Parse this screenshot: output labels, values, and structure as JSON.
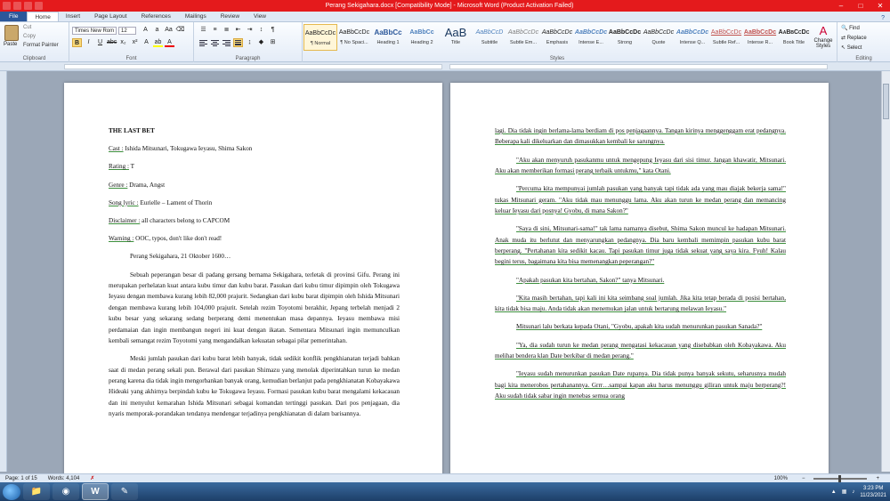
{
  "window": {
    "title": "Perang Sekigahara.docx [Compatibility Mode] - Microsoft Word (Product Activation Failed)"
  },
  "tabs": [
    "File",
    "Home",
    "Insert",
    "Page Layout",
    "References",
    "Mailings",
    "Review",
    "View"
  ],
  "ribbon": {
    "clipboard": {
      "paste": "Paste",
      "cut": "Cut",
      "copy": "Copy",
      "format_painter": "Format Painter",
      "label": "Clipboard"
    },
    "font": {
      "name": "Times New Rom",
      "size": "12",
      "label": "Font"
    },
    "paragraph": {
      "label": "Paragraph"
    },
    "styles": {
      "label": "Styles",
      "items": [
        {
          "preview": "AaBbCcDc",
          "name": "¶ Normal"
        },
        {
          "preview": "AaBbCcDc",
          "name": "¶ No Spaci..."
        },
        {
          "preview": "AaBbCc",
          "name": "Heading 1"
        },
        {
          "preview": "AaBbCc",
          "name": "Heading 2"
        },
        {
          "preview": "AaB",
          "name": "Title"
        },
        {
          "preview": "AaBbCcD",
          "name": "Subtitle"
        },
        {
          "preview": "AaBbCcDc",
          "name": "Subtle Em..."
        },
        {
          "preview": "AaBbCcDc",
          "name": "Emphasis"
        },
        {
          "preview": "AaBbCcDc",
          "name": "Intense E..."
        },
        {
          "preview": "AaBbCcDc",
          "name": "Strong"
        },
        {
          "preview": "AaBbCcDc",
          "name": "Quote"
        },
        {
          "preview": "AaBbCcDc",
          "name": "Intense Q..."
        },
        {
          "preview": "AaBbCcDc",
          "name": "Subtle Ref..."
        },
        {
          "preview": "AaBbCcDc",
          "name": "Intense R..."
        },
        {
          "preview": "AaBbCcDc",
          "name": "Book Title"
        }
      ],
      "change": "Change Styles"
    },
    "editing": {
      "find": "Find",
      "replace": "Replace",
      "select": "Select",
      "label": "Editing"
    }
  },
  "doc_left": {
    "title": "THE LAST BET",
    "lines": [
      {
        "k": "Cast :",
        "v": " Ishida Mitsunari, Tokugawa Ieyasu, Shima Sakon"
      },
      {
        "k": "Rating :",
        "v": " T"
      },
      {
        "k": "Genre :",
        "v": " Drama, Angst"
      },
      {
        "k": "Song lyric :",
        "v": " Eurielle – Lament of Thorin"
      },
      {
        "k": "Disclaimer :",
        "v": " all characters belong to CAPCOM"
      },
      {
        "k": "Warning :",
        "v": " OOC, typos, don't like don't read!"
      }
    ],
    "dateline": "Perang Sekigahara, 21 Oktober 1600…",
    "para1": "Sebuah peperangan besar di padang gersang bernama Sekigahara, terletak di provinsi Gifu. Perang ini merupakan perhelatan kuat antara kubu timur dan kubu barat. Pasukan dari kubu timur dipimpin oleh Tokugawa Ieyasu dengan membawa kurang lebih 82,000 prajurit. Sedangkan dari kubu barat dipimpin oleh Ishida Mitsunari dengan membawa kurang lebih 104,000 prajurit. Setelah rezim Toyotomi berakhir, Jepang terbelah menjadi 2 kubu besar yang sekarang sedang berperang demi menentukan masa depannya. Ieyasu membawa misi perdamaian dan ingin membangun negeri ini kuat dengan ikatan. Sementara Mitsunari ingin memuncul­kan kembali semangat rezim Toyotomi yang mengandalkan kekuatan sebagai pilar pemerintahan.",
    "para2": "Meski jumlah pasukan dari kubu barat lebih banyak, tidak sedikit konflik pengkhianatan terjadi bahkan saat di medan perang sekali pun. Berawal dari pasukan Shimazu yang menolak diperintahkan turun ke medan perang karena dia tidak ingin mengorbankan banyak orang, kemudian berlanjut pada pengkhianatan Kobayakawa Hideaki yang akhirnya berpindah kubu ke Tokugawa Ieyasu. Formasi pasukan kubu barat mengalami kekacauan dan ini menyulut kemarahan Ishida Mitsunari sebagai komandan tertinggi pasukan. Dari pos penjagaan, dia nyaris memporak-porandakan tenda­nya mendengar terjadinya pengkhianatan di dalam barisannya."
  },
  "doc_right": {
    "paras": [
      {
        "indent": false,
        "text": "lagi. Dia tidak ingin berlama-lama berdiam di pos penjagaannya. Tangan kirinya menggenggam erat pedangnya. Beberapa kali dikeluarkan dan dimasukkan kembali ke sarungnya."
      },
      {
        "indent": true,
        "text": "\"Aku akan menyuruh pasukanmu untuk mengepung Ieyasu dari sisi timur. Jangan khawatir, Mitsunari. Aku akan memberikan formasi perang terbaik untukmu,\" kata Otani."
      },
      {
        "indent": true,
        "text": "\"Percuma kita mempunyai jumlah pasukan yang banyak tapi tidak ada yang mau diajak bekerja sama!\" tukas Mitsunari geram. \"Aku tidak mau menunggu lama. Aku akan turun ke medan perang dan memancing keluar Ieyasu dari posnya! Gyobu, di mana Sakon?\""
      },
      {
        "indent": true,
        "text": "\"Saya di sini, Mitsunari-sama!\" tak lama namanya disebut, Shima Sakon muncul ke hadapan Mitsunari. Anak muda itu berlutut dan menyarungkan pedangnya. Dia baru kembali memimpin pasukan kubu barat berperang. \"Pertahanan kita sedikit kacau. Tapi pasukan timur juga tidak sekuat yang saya kira. Fyuh! Kalau begini terus, bagaimana kita bisa memenangkan peperangan?\""
      },
      {
        "indent": true,
        "text": "\"Apakah pasukan kita bertahan, Sakon?\" tanya Mitsunari."
      },
      {
        "indent": true,
        "text": "\"Kita masih bertahan, tapi kali ini kita seimbang soal jumlah. Jika kita tetap berada di posisi bertahan, kita tidak bisa maju. Anda tidak akan menemukan jalan untuk bertarung melawan Ieyasu.\""
      },
      {
        "indent": true,
        "text": "Mitsunari lalu berkata kepada Otani, \"Gyobu, apakah kita sudah menurunkan pasukan Sanada?\""
      },
      {
        "indent": true,
        "text": "\"Ya, dia sudah turun ke medan perang mengatasi kekacauan yang disebabkan oleh Kobayakawa. Aku melihat bendera klan Date berkibar di medan perang.\""
      },
      {
        "indent": true,
        "text": "\"Ieyasu sudah menurunkan pasukan Date rupanya. Dia tidak punya banyak sekutu, seharusnya mudah bagi kita menerobos pertahanannya. Grrr…sampai kapan aku harus menunggu giliran untuk maju berperang?! Aku sudah tidak sabar ingin menebas semua orang"
      }
    ]
  },
  "status": {
    "page": "Page: 1 of 15",
    "words": "Words: 4,104",
    "zoom": "100%"
  },
  "taskbar": {
    "time": "3:23 PM",
    "date": "11/23/2021"
  }
}
